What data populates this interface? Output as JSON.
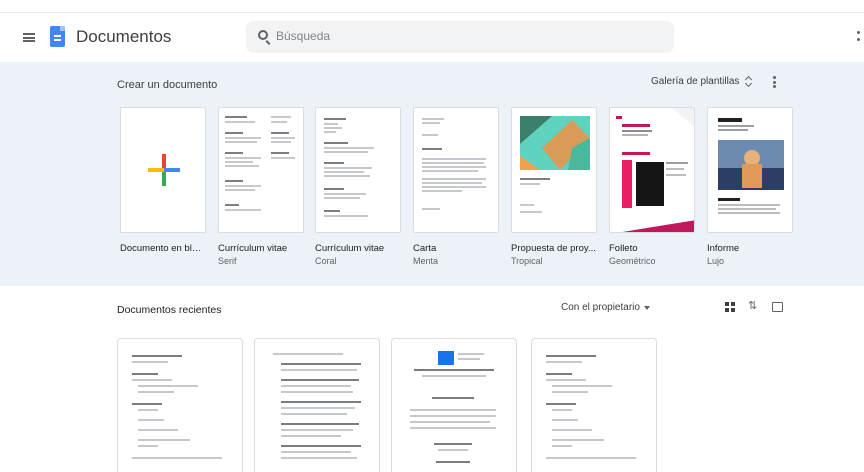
{
  "header": {
    "app_title": "Documentos",
    "search_placeholder": "Búsqueda"
  },
  "templates": {
    "section_label": "Crear un documento",
    "gallery_label": "Galería de plantillas",
    "items": [
      {
        "name": "Documento en blan...",
        "subtitle": ""
      },
      {
        "name": "Currículum vitae",
        "subtitle": "Serif"
      },
      {
        "name": "Currículum vitae",
        "subtitle": "Coral"
      },
      {
        "name": "Carta",
        "subtitle": "Menta"
      },
      {
        "name": "Propuesta de proy...",
        "subtitle": "Tropical"
      },
      {
        "name": "Folleto",
        "subtitle": "Geométrico"
      },
      {
        "name": "Informe",
        "subtitle": "Lujo"
      }
    ]
  },
  "recent": {
    "section_label": "Documentos recientes",
    "owner_filter": "Con el propietario"
  },
  "colors": {
    "accent": "#4285f4",
    "template_bg": "#edf1f8"
  }
}
